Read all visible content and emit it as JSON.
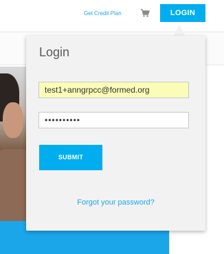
{
  "header": {
    "credit_link": "Get Credit Plan",
    "cart_icon": "cart-icon",
    "login_label": "LOGIN"
  },
  "login_popup": {
    "title": "Login",
    "email_value": "test1+anngrpcc@formed.org",
    "password_value": "••••••••••",
    "submit_label": "SUBMIT",
    "forgot_link": "Forgot your password?"
  },
  "colors": {
    "accent": "#00aeef",
    "link": "#1ba6e8",
    "autofill_bg": "#fafcb8",
    "popup_bg": "#f2f2f2"
  }
}
